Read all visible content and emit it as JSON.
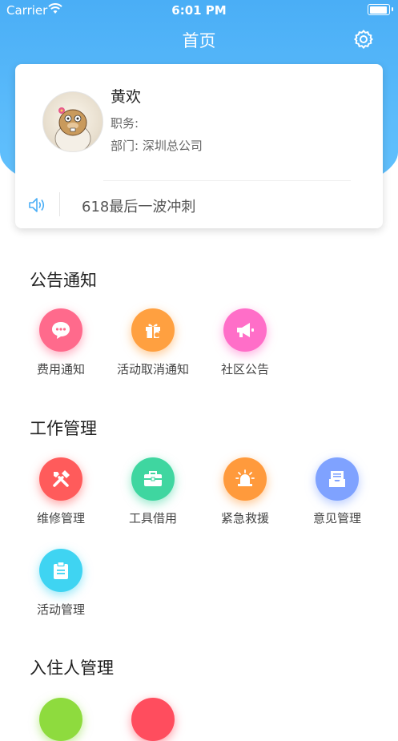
{
  "status_bar": {
    "carrier": "Carrier",
    "time": "6:01 PM"
  },
  "nav": {
    "title": "首页"
  },
  "profile": {
    "name": "黄欢",
    "position_label": "职务:",
    "department": "部门:  深圳总公司"
  },
  "announcement": {
    "text": "618最后一波冲刺"
  },
  "sections": {
    "notices": {
      "title": "公告通知",
      "items": [
        {
          "label": "费用通知",
          "icon": "chat-bubble-icon",
          "color": "#ff6a8c"
        },
        {
          "label": "活动取消通知",
          "icon": "gift-icon",
          "color": "#ffa040"
        },
        {
          "label": "社区公告",
          "icon": "megaphone-icon",
          "color": "#ff6ec8"
        }
      ]
    },
    "work": {
      "title": "工作管理",
      "items": [
        {
          "label": "维修管理",
          "icon": "tools-icon",
          "color": "#ff5b5b"
        },
        {
          "label": "工具借用",
          "icon": "toolbox-icon",
          "color": "#3fd6a0"
        },
        {
          "label": "紧急救援",
          "icon": "alarm-icon",
          "color": "#ff9a3c"
        },
        {
          "label": "意见管理",
          "icon": "inbox-icon",
          "color": "#7fa2ff"
        },
        {
          "label": "活动管理",
          "icon": "clipboard-icon",
          "color": "#3fd4f2"
        }
      ]
    },
    "residents": {
      "title": "入住人管理"
    }
  },
  "colors": {
    "header": "#5cbcfb",
    "accent_speaker": "#4aaef6"
  }
}
